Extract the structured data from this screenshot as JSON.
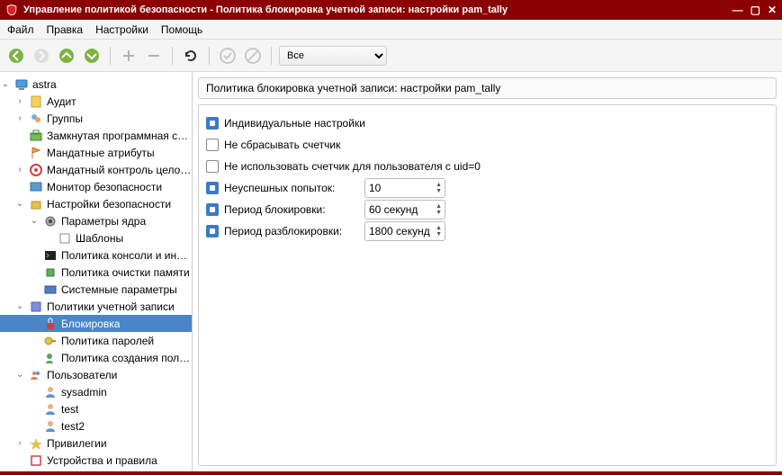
{
  "title": "Управление политикой безопасности - Политика блокировка учетной записи: настройки pam_tally",
  "menu": {
    "file": "Файл",
    "edit": "Правка",
    "settings": "Настройки",
    "help": "Помощь"
  },
  "filter": {
    "value": "Все"
  },
  "tree": {
    "root": "astra",
    "audit": "Аудит",
    "groups": "Группы",
    "closed_env": "Замкнутая программная среда",
    "mand_attr": "Мандатные атрибуты",
    "mand_integ": "Мандатный контроль целостности",
    "sec_monitor": "Монитор безопасности",
    "sec_settings": "Настройки безопасности",
    "kernel": "Параметры ядра",
    "templates": "Шаблоны",
    "console_policy": "Политика консоли и интерпр...",
    "mem_clear": "Политика очистки памяти",
    "sys_params": "Системные параметры",
    "acct_policy": "Политики учетной записи",
    "lockout": "Блокировка",
    "pwd_policy": "Политика паролей",
    "user_create": "Политика создания пользова...",
    "users": "Пользователи",
    "sysadmin": "sysadmin",
    "test": "test",
    "test2": "test2",
    "privileges": "Привилегии",
    "devices": "Устройства и правила"
  },
  "panel": {
    "header": "Политика блокировка учетной записи: настройки pam_tally",
    "individual": "Индивидуальные настройки",
    "no_reset": "Не сбрасывать счетчик",
    "no_counter_uid0": "Не использовать счетчик для пользователя с uid=0",
    "fail_attempts_label": "Неуспешных попыток:",
    "fail_attempts_value": "10",
    "lock_period_label": "Период блокировки:",
    "lock_period_value": "60 секунд",
    "unlock_period_label": "Период разблокировки:",
    "unlock_period_value": "1800 секунд"
  }
}
